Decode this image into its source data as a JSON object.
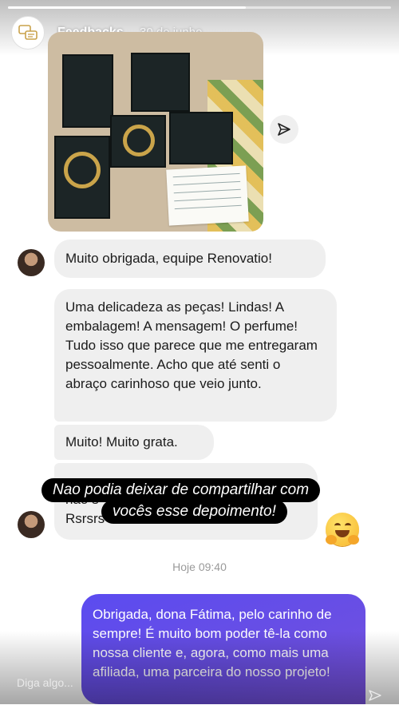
{
  "story": {
    "title": "Feedbacks",
    "date": "30 de junho",
    "progress": 0.62
  },
  "chat": {
    "messages_received": [
      "Muito obrigada, equipe Renovatio!",
      "Uma delicadeza as peças! Lindas! A embalagem! A mensagem! O perfume! Tudo isso que parece que me entregaram pessoalmente. Acho que até senti o abraço carinhoso que veio junto.",
      "Muito! Muito grata."
    ],
    "partial_message_line1": "não s",
    "partial_message_line2": "Rsrsrs",
    "timestamp": "Hoje 09:40",
    "message_sent": "Obrigada, dona Fátima, pelo carinho de sempre! É muito bom poder tê-la como nossa cliente e, agora, como mais uma afiliada, uma parceira do nosso projeto!"
  },
  "overlay": {
    "line1": "Nao podia deixar de compartilhar com",
    "line2": "vocês esse depoimento!"
  },
  "reply": {
    "placeholder": "Diga algo..."
  },
  "colors": {
    "sent_bubble": "#5b4bf0",
    "received_bubble": "#efefef"
  }
}
